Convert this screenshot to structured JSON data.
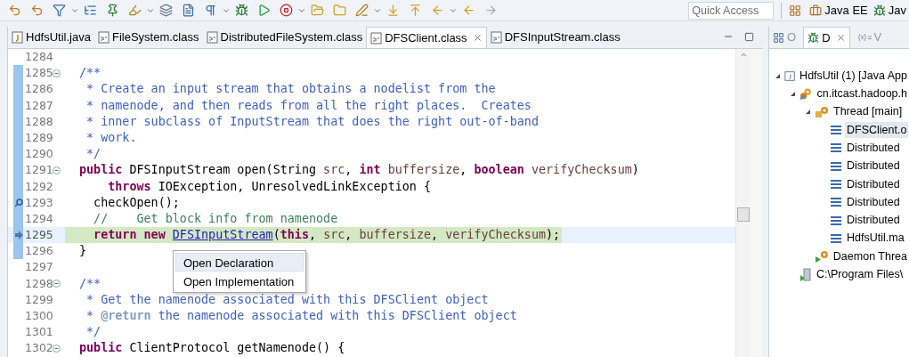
{
  "toolbar": {
    "quick_access": {
      "placeholder": "Quick Access"
    },
    "perspectives": [
      {
        "label": "Java EE",
        "kind": "javaee"
      },
      {
        "label": "Jav",
        "kind": "debug"
      }
    ]
  },
  "editor_tabs": [
    {
      "label": "HdfsUtil.java",
      "kind": "java",
      "selected": false
    },
    {
      "label": "FileSystem.class",
      "kind": "class",
      "selected": false
    },
    {
      "label": "DistributedFileSystem.class",
      "kind": "class",
      "selected": false
    },
    {
      "label": "DFSClient.class",
      "kind": "class",
      "selected": true
    },
    {
      "label": "DFSInputStream.class",
      "kind": "class",
      "selected": false
    }
  ],
  "code_lines": [
    {
      "number": "1284",
      "foldable": false,
      "changed": false,
      "annotated": false,
      "current": false
    },
    {
      "number": "1285",
      "foldable": true,
      "changed": true,
      "annotated": false,
      "current": false,
      "tokens": [
        {
          "kind": "doc",
          "text": "/**"
        }
      ]
    },
    {
      "number": "1286",
      "foldable": false,
      "changed": true,
      "annotated": false,
      "current": false,
      "tokens": [
        {
          "kind": "doc",
          "text": " * Create an input stream that obtains a nodelist from the"
        }
      ]
    },
    {
      "number": "1287",
      "foldable": false,
      "changed": true,
      "annotated": false,
      "current": false,
      "tokens": [
        {
          "kind": "doc",
          "text": " * namenode, and then reads from all the right places.  Creates"
        }
      ]
    },
    {
      "number": "1288",
      "foldable": false,
      "changed": true,
      "annotated": false,
      "current": false,
      "tokens": [
        {
          "kind": "doc",
          "text": " * inner subclass of InputStream that does the right out-of-band"
        }
      ]
    },
    {
      "number": "1289",
      "foldable": false,
      "changed": true,
      "annotated": false,
      "current": false,
      "tokens": [
        {
          "kind": "doc",
          "text": " * work."
        }
      ]
    },
    {
      "number": "1290",
      "foldable": false,
      "changed": true,
      "annotated": false,
      "current": false,
      "tokens": [
        {
          "kind": "doc",
          "text": " */"
        }
      ]
    },
    {
      "number": "1291",
      "foldable": true,
      "changed": true,
      "annotated": false,
      "current": false,
      "tokens": [
        {
          "kind": "keyword",
          "text": "public"
        },
        {
          "kind": "text",
          "text": " DFSInputStream open(String "
        },
        {
          "kind": "param",
          "text": "src"
        },
        {
          "kind": "text",
          "text": ", "
        },
        {
          "kind": "keyword",
          "text": "int"
        },
        {
          "kind": "param",
          "text": " buffersize"
        },
        {
          "kind": "text",
          "text": ", "
        },
        {
          "kind": "keyword",
          "text": "boolean"
        },
        {
          "kind": "param",
          "text": " verifyChecksum"
        },
        {
          "kind": "text",
          "text": ")"
        }
      ]
    },
    {
      "number": "1292",
      "foldable": false,
      "changed": true,
      "annotated": false,
      "current": false,
      "tokens": [
        {
          "kind": "keyword",
          "text": "    throws"
        },
        {
          "kind": "text",
          "text": " IOException, UnresolvedLinkException {"
        }
      ]
    },
    {
      "number": "1293",
      "foldable": false,
      "changed": true,
      "annotated": true,
      "current": false,
      "tokens": [
        {
          "kind": "text",
          "text": "  checkOpen();"
        }
      ]
    },
    {
      "number": "1294",
      "foldable": false,
      "changed": true,
      "annotated": false,
      "current": false,
      "tokens": [
        {
          "kind": "comment",
          "text": "  //    Get block info from namenode"
        }
      ]
    },
    {
      "number": "1295",
      "foldable": false,
      "changed": true,
      "annotated": false,
      "current": true,
      "tokens": [
        {
          "kind": "keyword",
          "text": "  return new "
        },
        {
          "kind": "link",
          "text": "DFSInputStream"
        },
        {
          "kind": "text",
          "text": "("
        },
        {
          "kind": "keyword",
          "text": "this"
        },
        {
          "kind": "text",
          "text": ", "
        },
        {
          "kind": "param",
          "text": "src"
        },
        {
          "kind": "text",
          "text": ", "
        },
        {
          "kind": "param",
          "text": "buffersize"
        },
        {
          "kind": "text",
          "text": ", "
        },
        {
          "kind": "param",
          "text": "verifyChecksum"
        },
        {
          "kind": "text",
          "text": ");"
        }
      ]
    },
    {
      "number": "1296",
      "foldable": false,
      "changed": true,
      "annotated": false,
      "current": false,
      "tokens": [
        {
          "kind": "text",
          "text": "}"
        }
      ]
    },
    {
      "number": "1297",
      "foldable": false,
      "changed": false,
      "annotated": false,
      "current": false
    },
    {
      "number": "1298",
      "foldable": true,
      "changed": false,
      "annotated": false,
      "current": false,
      "tokens": [
        {
          "kind": "doc",
          "text": "/**"
        }
      ]
    },
    {
      "number": "1299",
      "foldable": false,
      "changed": false,
      "annotated": false,
      "current": false,
      "tokens": [
        {
          "kind": "doc",
          "text": " * Get the namenode associated with this DFSClient object"
        }
      ]
    },
    {
      "number": "1300",
      "foldable": false,
      "changed": false,
      "annotated": false,
      "current": false,
      "tokens": [
        {
          "kind": "doc",
          "text": " * "
        },
        {
          "kind": "doctag",
          "text": "@return"
        },
        {
          "kind": "doc",
          "text": " the namenode associated with this DFSClient object"
        }
      ]
    },
    {
      "number": "1301",
      "foldable": false,
      "changed": false,
      "annotated": false,
      "current": false,
      "tokens": [
        {
          "kind": "doc",
          "text": " */"
        }
      ]
    },
    {
      "number": "1302",
      "foldable": true,
      "changed": false,
      "annotated": false,
      "current": false,
      "tokens": [
        {
          "kind": "keyword",
          "text": "public"
        },
        {
          "kind": "text",
          "text": " ClientProtocol getNamenode() {"
        }
      ]
    }
  ],
  "context_menu": {
    "items": [
      {
        "label": "Open Declaration",
        "selected": true
      },
      {
        "label": "Open Implementation",
        "selected": false
      }
    ]
  },
  "side_panel": {
    "tabs": [
      {
        "label": "O",
        "kind": "outline",
        "selected": false
      },
      {
        "label": "D",
        "kind": "debug",
        "selected": true
      },
      {
        "label": "V",
        "kind": "variables",
        "selected": false
      }
    ],
    "tree": [
      {
        "label": "HdfsUtil (1) [Java App",
        "kind": "app",
        "expanded": true,
        "selected": false,
        "children": [
          {
            "label": "cn.itcast.hadoop.h",
            "kind": "process",
            "expanded": true,
            "selected": false,
            "children": [
              {
                "label": "Thread [main]",
                "kind": "thread",
                "expanded": true,
                "selected": false,
                "children": [
                  {
                    "label": "DFSClient.o",
                    "kind": "frame",
                    "selected": true
                  },
                  {
                    "label": "Distributed",
                    "kind": "frame",
                    "selected": false
                  },
                  {
                    "label": "Distributed",
                    "kind": "frame",
                    "selected": false
                  },
                  {
                    "label": "Distributed",
                    "kind": "frame",
                    "selected": false
                  },
                  {
                    "label": "Distributed",
                    "kind": "frame",
                    "selected": false
                  },
                  {
                    "label": "Distributed",
                    "kind": "frame",
                    "selected": false
                  },
                  {
                    "label": "HdfsUtil.ma",
                    "kind": "frame",
                    "selected": false
                  }
                ]
              },
              {
                "label": "Daemon Threa",
                "kind": "daemon",
                "selected": false
              }
            ]
          },
          {
            "label": "C:\\Program Files\\",
            "kind": "vm",
            "selected": false
          }
        ]
      }
    ]
  }
}
